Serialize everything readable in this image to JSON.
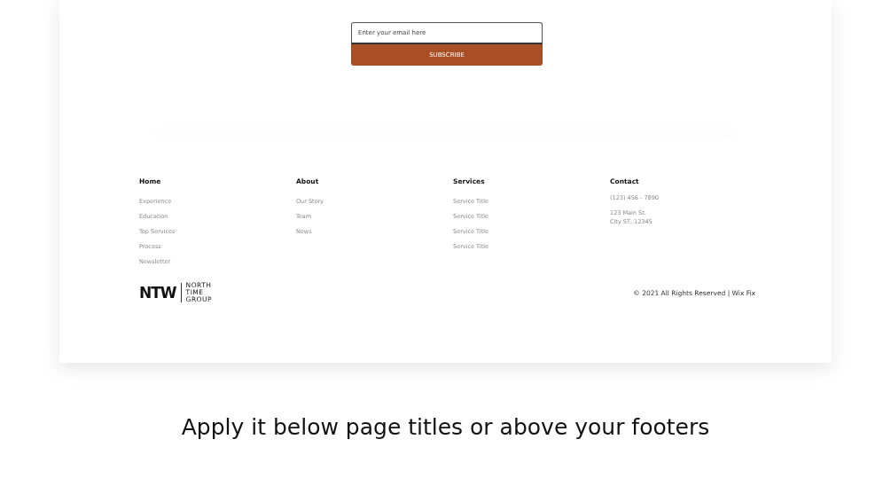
{
  "subscribe": {
    "placeholder": "Enter your email here",
    "button": "SUBSCRIBE"
  },
  "columns": [
    {
      "heading": "Home",
      "links": [
        "Experience",
        "Education",
        "Top Services",
        "Process",
        "Newsletter"
      ]
    },
    {
      "heading": "About",
      "links": [
        "Our Story",
        "Team",
        "News"
      ]
    },
    {
      "heading": "Services",
      "links": [
        "Service Title",
        "Service Title",
        "Service Title",
        "Service Title"
      ]
    },
    {
      "heading": "Contact",
      "lines": [
        "(123) 456 - 7890",
        "123 Main St.\nCity ST, 12345"
      ]
    }
  ],
  "logo": {
    "mark": "NTW",
    "words": [
      "NORTH",
      "TIME",
      "GROUP"
    ]
  },
  "copyright": "© 2021 All Rights Reserved | Wix Fix",
  "caption": "Apply it below page titles or above your footers"
}
